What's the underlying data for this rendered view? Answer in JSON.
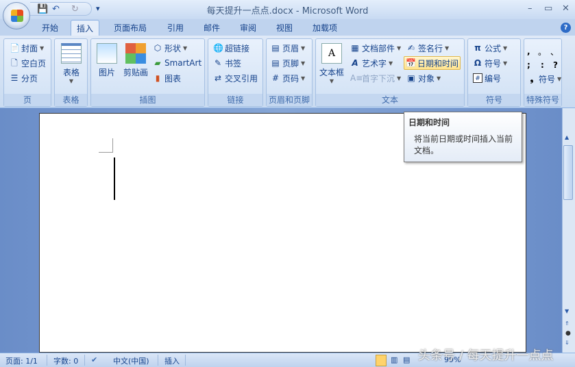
{
  "window": {
    "title": "每天提升一点点.docx - Microsoft Word",
    "minimize": "–",
    "maximize": "▭",
    "close": "✕"
  },
  "qat": {
    "save": "💾",
    "undo": "↶",
    "redo": "↻",
    "customize": "▾"
  },
  "tabs": [
    "开始",
    "插入",
    "页面布局",
    "引用",
    "邮件",
    "审阅",
    "视图",
    "加载项"
  ],
  "active_tab": "插入",
  "help": "?",
  "groups": {
    "page": {
      "label": "页",
      "items": [
        "封面",
        "空白页",
        "分页"
      ]
    },
    "table": {
      "label": "表格",
      "button": "表格"
    },
    "illustrations": {
      "label": "插图",
      "picture": "图片",
      "clipart": "剪贴画",
      "shapes": "形状",
      "smartart": "SmartArt",
      "chart": "图表"
    },
    "links": {
      "label": "链接",
      "items": [
        "超链接",
        "书签",
        "交叉引用"
      ]
    },
    "header_footer": {
      "label": "页眉和页脚",
      "items": [
        "页眉",
        "页脚",
        "页码"
      ]
    },
    "text": {
      "label": "文本",
      "textbox": "文本框",
      "quickparts": "文档部件",
      "wordart": "艺术字",
      "dropcap": "首字下沉",
      "signature": "签名行",
      "datetime": "日期和时间",
      "object": "对象"
    },
    "symbols": {
      "label": "符号",
      "equation": "公式",
      "symbol": "符号",
      "number": "编号"
    },
    "special": {
      "label": "特殊符号",
      "chars": [
        ",",
        "。",
        "、",
        ";",
        ":",
        "?"
      ],
      "symbol": "符号"
    }
  },
  "tooltip": {
    "title": "日期和时间",
    "body": "将当前日期或时间插入当前文档。"
  },
  "status": {
    "page": "页面: 1/1",
    "words": "字数: 0",
    "language": "中文(中国)",
    "mode": "插入",
    "zoom": "99%"
  },
  "watermark": "头条号 / 每天提升一点点"
}
